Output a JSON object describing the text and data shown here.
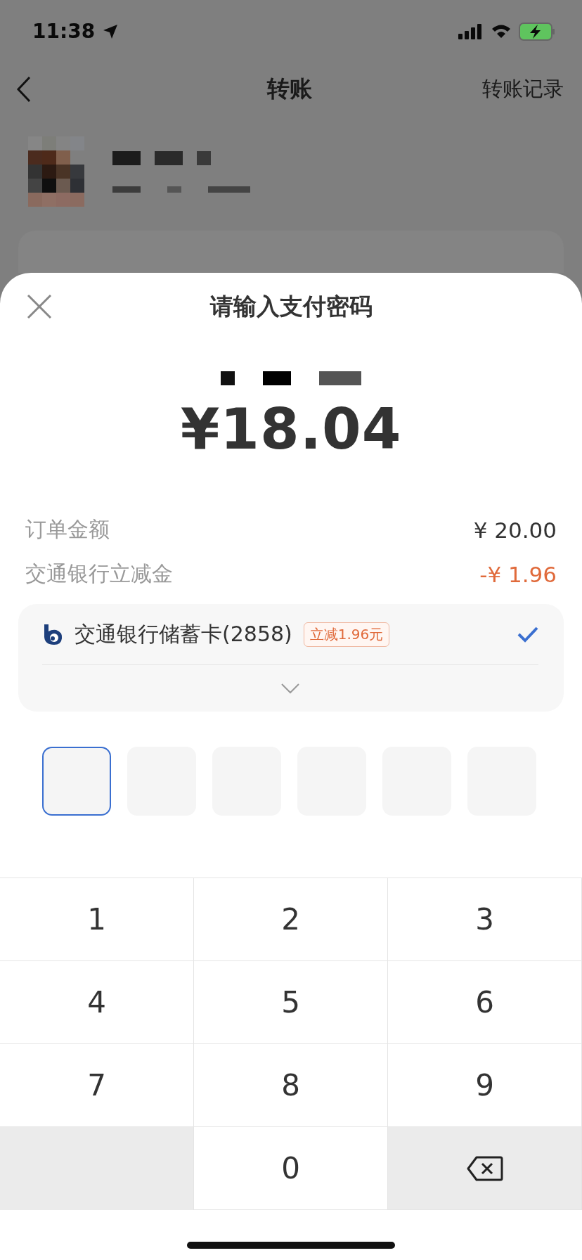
{
  "status_bar": {
    "time": "11:38"
  },
  "nav": {
    "title": "转账",
    "action": "转账记录"
  },
  "payment_sheet": {
    "title": "请输入支付密码",
    "amount": "¥18.04",
    "breakdown": [
      {
        "label": "订单金额",
        "value": "¥ 20.00",
        "kind": "normal"
      },
      {
        "label": "交通银行立减金",
        "value": "-¥ 1.96",
        "kind": "discount"
      }
    ],
    "method": {
      "name": "交通银行储蓄卡(2858)",
      "badge": "立减1.96元",
      "selected": true
    },
    "pin": [
      {
        "selected": true
      },
      {
        "selected": false
      },
      {
        "selected": false
      },
      {
        "selected": false
      },
      {
        "selected": false
      },
      {
        "selected": false
      }
    ]
  },
  "keypad": [
    {
      "kind": "digit",
      "label": "1"
    },
    {
      "kind": "digit",
      "label": "2"
    },
    {
      "kind": "digit",
      "label": "3"
    },
    {
      "kind": "digit",
      "label": "4"
    },
    {
      "kind": "digit",
      "label": "5"
    },
    {
      "kind": "digit",
      "label": "6"
    },
    {
      "kind": "digit",
      "label": "7"
    },
    {
      "kind": "digit",
      "label": "8"
    },
    {
      "kind": "digit",
      "label": "9"
    },
    {
      "kind": "blank"
    },
    {
      "kind": "digit",
      "label": "0"
    },
    {
      "kind": "backspace"
    }
  ]
}
